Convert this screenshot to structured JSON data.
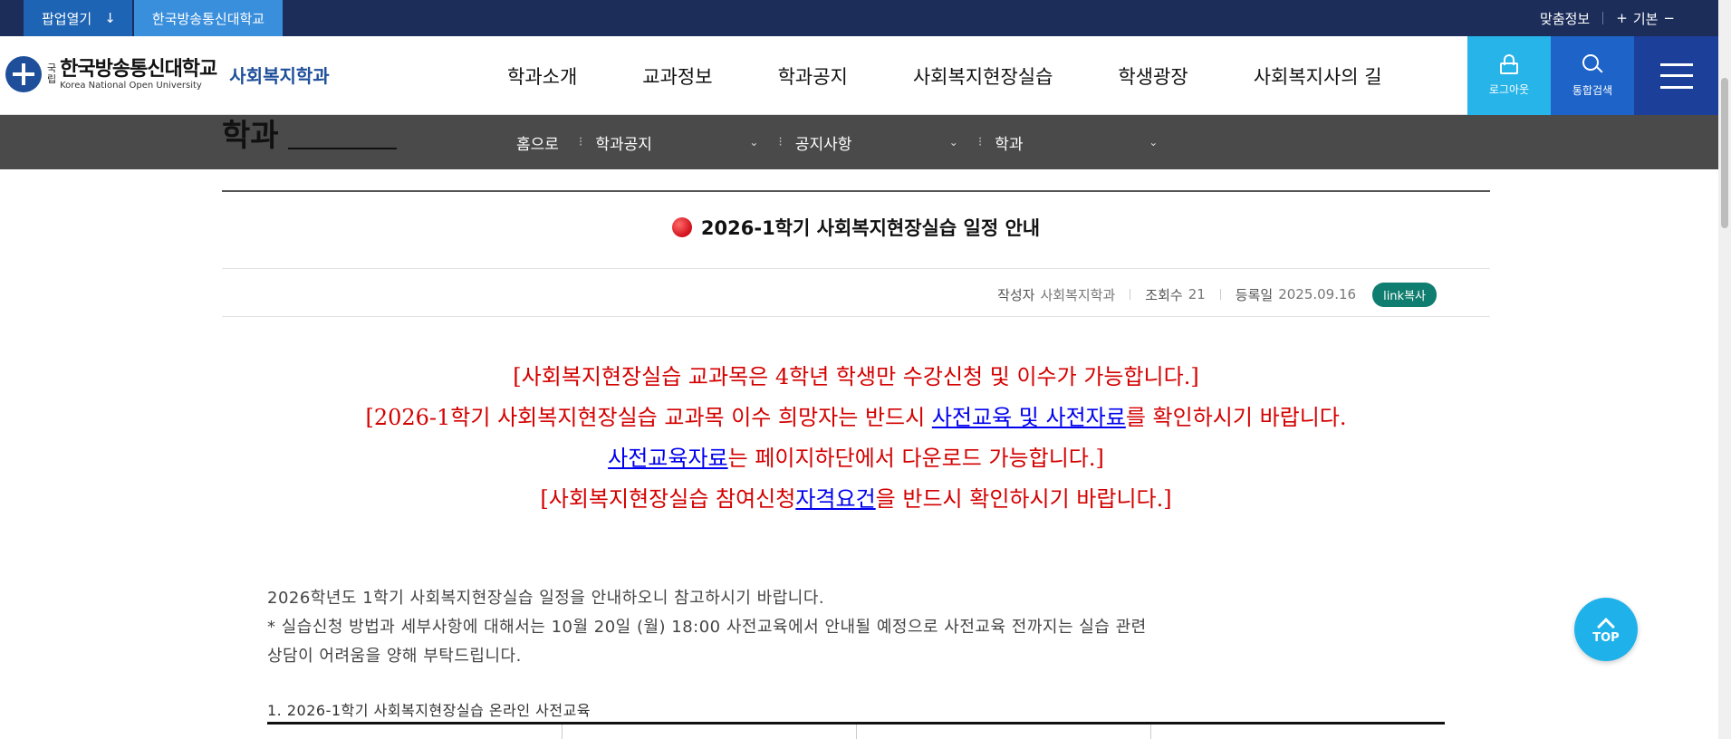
{
  "topbar": {
    "popup_label": "팝업열기",
    "popup_icon": "arrow-down-icon",
    "university_label": "한국방송통신대학교",
    "custom_info_label": "맞춤정보",
    "font_plus": "+",
    "font_default_label": "기본",
    "font_minus": "−"
  },
  "header": {
    "logo_gukrip_top": "국",
    "logo_gukrip_bottom": "립",
    "logo_name_ko": "한국방송통신대학교",
    "logo_name_en": "Korea National Open University",
    "department": "사회복지학과",
    "nav": [
      "학과소개",
      "교과정보",
      "학과공지",
      "사회복지현장실습",
      "학생광장",
      "사회복지사의 길"
    ],
    "logout_label": "로그아웃",
    "search_label": "통합검색",
    "menu_icon": "hamburger-menu-icon"
  },
  "breadcrumb": {
    "section_title": "학과",
    "home_label": "홈으로",
    "level1": "학과공지",
    "level2": "공지사항",
    "level3": "학과"
  },
  "article": {
    "title": "2026-1학기 사회복지현장실습 일정 안내",
    "author_label": "작성자",
    "author": "사회복지학과",
    "views_label": "조회수",
    "views": "21",
    "date_label": "등록일",
    "date": "2025.09.16",
    "link_copy_label": "link복사",
    "notice1": "[사회복지현장실습 교과목은 4학년 학생만 수강신청 및 이수가 가능합니다.]",
    "notice2_pre": "[2026-1학기 사회복지현장실습 교과목 이수 희망자는 반드시 ",
    "notice2_link": "사전교육 및 사전자료",
    "notice2_post": "를 확인하시기 바랍니다.",
    "notice3_link": "사전교육자료",
    "notice3_post": "는 페이지하단에서 다운로드 가능합니다.]",
    "notice4_pre": "[사회복지현장실습 참여신청",
    "notice4_link": "자격요건",
    "notice4_post": "을 반드시 확인하시기 바랍니다.]",
    "body1": "2026학년도 1학기 사회복지현장실습 일정을 안내하오니 참고하시기 바랍니다.",
    "body2": "* 실습신청 방법과 세부사항에 대해서는 10월 20일 (월) 18:00 사전교육에서 안내될 예정으로 사전교육 전까지는 실습 관련",
    "body3": "상담이 어려움을 양해 부탁드립니다.",
    "section1": "1. 2026-1학기 사회복지현장실습 온라인 사전교육"
  },
  "top_button_label": "TOP",
  "colors": {
    "topbar": "#1c2d5a",
    "popup": "#1e64b4",
    "univ": "#3a8fdc",
    "logout": "#27b4e8",
    "search": "#1e64c8",
    "menu": "#1c3f9a",
    "crumbbar": "#4a4a4a",
    "notice_red": "#d40000",
    "link_blue": "#0000ee",
    "link_copy": "#0f7d6f",
    "top_button": "#1fb2ea"
  }
}
